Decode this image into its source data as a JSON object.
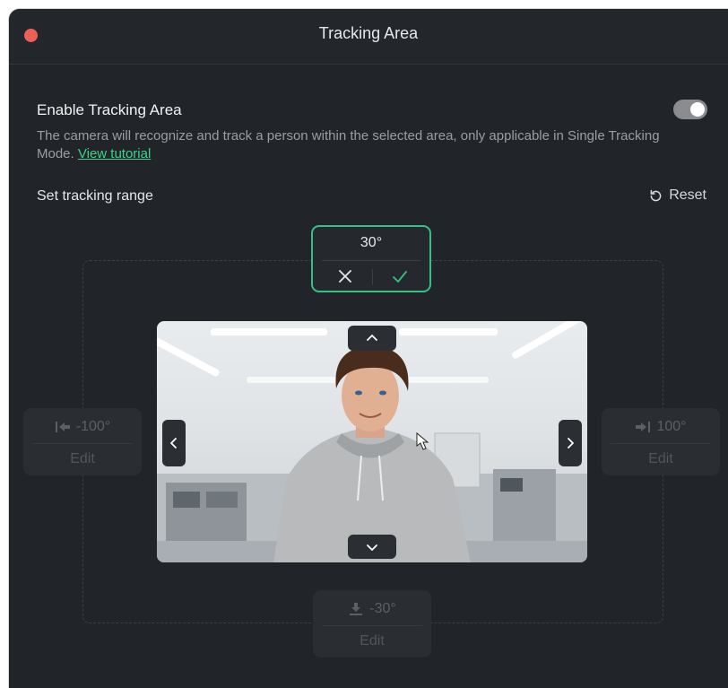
{
  "window": {
    "title": "Tracking Area"
  },
  "settings": {
    "enable_label": "Enable Tracking Area",
    "enabled": true,
    "description": "The camera will recognize and track a person within the selected area, only applicable in Single Tracking Mode.",
    "tutorial_link": "View tutorial",
    "range_label": "Set tracking range",
    "reset_label": "Reset"
  },
  "range": {
    "top": {
      "value": "30°",
      "cancel_icon": "close-icon",
      "confirm_icon": "check-icon"
    },
    "left": {
      "value": "-100°",
      "edit": "Edit",
      "icon": "arrow-left-to-bar-icon"
    },
    "right": {
      "value": "100°",
      "edit": "Edit",
      "icon": "arrow-right-to-bar-icon"
    },
    "bottom": {
      "value": "-30°",
      "edit": "Edit",
      "icon": "arrow-down-to-bar-icon"
    }
  },
  "colors": {
    "accent": "#32c283",
    "background": "#212429",
    "close": "#ee5f58"
  }
}
